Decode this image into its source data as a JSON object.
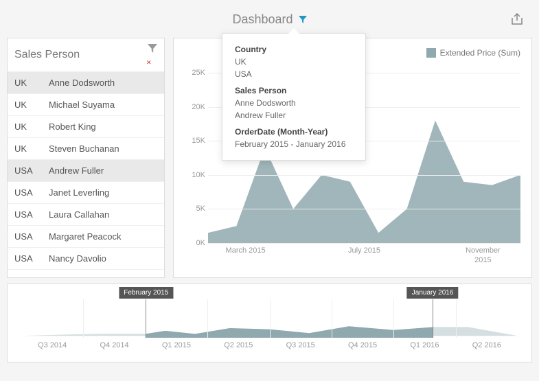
{
  "header": {
    "title": "Dashboard"
  },
  "grid": {
    "header": "Sales Person",
    "rows": [
      {
        "country": "UK",
        "name": "Anne Dodsworth",
        "selected": true
      },
      {
        "country": "UK",
        "name": "Michael Suyama",
        "selected": false
      },
      {
        "country": "UK",
        "name": "Robert King",
        "selected": false
      },
      {
        "country": "UK",
        "name": "Steven Buchanan",
        "selected": false
      },
      {
        "country": "USA",
        "name": "Andrew Fuller",
        "selected": true
      },
      {
        "country": "USA",
        "name": "Janet Leverling",
        "selected": false
      },
      {
        "country": "USA",
        "name": "Laura Callahan",
        "selected": false
      },
      {
        "country": "USA",
        "name": "Margaret Peacock",
        "selected": false
      },
      {
        "country": "USA",
        "name": "Nancy Davolio",
        "selected": false
      }
    ]
  },
  "tooltip": {
    "country_k": "Country",
    "country_v1": "UK",
    "country_v2": "USA",
    "sp_k": "Sales Person",
    "sp_v1": "Anne Dodsworth",
    "sp_v2": "Andrew Fuller",
    "od_k": "OrderDate (Month-Year)",
    "od_v": "February 2015 - January 2016"
  },
  "legend": {
    "label": "Extended Price (Sum)"
  },
  "chart_data": {
    "type": "area",
    "title": "",
    "ylabel": "",
    "xlabel": "",
    "ylim": [
      0,
      25
    ],
    "yunit": "K",
    "y_ticks": [
      "0K",
      "5K",
      "10K",
      "15K",
      "20K",
      "25K"
    ],
    "x_ticks": [
      "March 2015",
      "July 2015",
      "November 2015"
    ],
    "x": [
      "Feb 2015",
      "Mar 2015",
      "Apr 2015",
      "May 2015",
      "Jun 2015",
      "Jul 2015",
      "Aug 2015",
      "Sep 2015",
      "Oct 2015",
      "Nov 2015",
      "Dec 2015",
      "Jan 2016"
    ],
    "series": [
      {
        "name": "Extended Price (Sum)",
        "values": [
          1.5,
          2.5,
          14,
          5,
          10,
          9,
          1.5,
          5,
          18,
          9,
          8.5,
          10
        ]
      }
    ]
  },
  "range": {
    "handle_left": "February 2015",
    "handle_right": "January 2016",
    "ticks": [
      "Q3 2014",
      "Q4 2014",
      "Q1 2015",
      "Q2 2015",
      "Q3 2015",
      "Q4 2015",
      "Q1 2016",
      "Q2 2016"
    ]
  }
}
